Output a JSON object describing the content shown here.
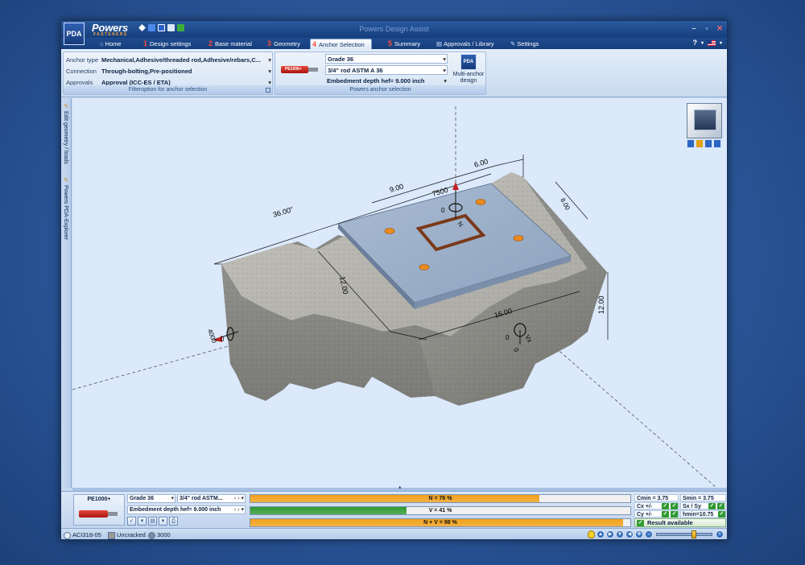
{
  "app": {
    "title": "Powers Design Assist",
    "logo_text": "PDA",
    "brand": "Powers",
    "brand_sub": "FASTENERS"
  },
  "tabs": [
    {
      "num": "",
      "label": "Home",
      "icon": "home-icon"
    },
    {
      "num": "1",
      "label": "Design settings"
    },
    {
      "num": "2",
      "label": "Base material"
    },
    {
      "num": "3",
      "label": "Geometry"
    },
    {
      "num": "4",
      "label": "Anchor Selection",
      "active": true
    },
    {
      "num": "5",
      "label": "Summary"
    },
    {
      "num": "",
      "label": "Approvals / Library",
      "icon": "book-icon"
    },
    {
      "num": "",
      "label": "Settings",
      "icon": "wrench-icon"
    }
  ],
  "help_label": "?",
  "filter_group": {
    "caption": "Filteroption for anchor selection",
    "rows": [
      {
        "label": "Anchor type",
        "value": "Mechanical,Adhesive/threaded rod,Adhesive/rebars,C..."
      },
      {
        "label": "Connection",
        "value": "Through-bolting,Pre-positioned"
      },
      {
        "label": "Approvals",
        "value": "Approval (ICC-ES / ETA)"
      }
    ]
  },
  "anchor_group": {
    "caption": "Powers anchor selection",
    "product_label": "PE1000+",
    "grade": "Grade 36",
    "rod": "3/4\" rod  ASTM A 36",
    "embedment": "Embedment depth hef= 9.000 inch",
    "multi_anchor_label": "Multi-anchor design",
    "multi_anchor_icon_text": "PDA"
  },
  "sidebar": {
    "items": [
      {
        "label": "Edit geometry / loads"
      },
      {
        "label": "Powers PDA-Explorer"
      }
    ]
  },
  "model": {
    "dims": [
      "36.00\"",
      "9.00",
      "6.00",
      "12.00",
      "16.00",
      "12.00",
      "8.00"
    ],
    "loads": {
      "moment_top": "7500",
      "zero_top": "0",
      "zero_left": "0",
      "moment_left": "4000",
      "moment_right": "0",
      "zero_right": "0"
    }
  },
  "results": {
    "product_label": "PE1000+",
    "grade": "Grade 36",
    "rod": "3/4\" rod  ASTM...",
    "embedment": "Embedment depth hef= 9.000 inch",
    "bars": [
      {
        "label": "N = 76 %",
        "value": 76,
        "color": "#f2a21b"
      },
      {
        "label": "V = 41 %",
        "value": 41,
        "color": "#2e9b32"
      },
      {
        "label": "N + V = 98 %",
        "value": 98,
        "color": "#f2a21b"
      }
    ],
    "checks": {
      "cmin": "Cmin = 3.75",
      "smin": "Smin = 3.75",
      "cx": "Cx +/-",
      "sx": "Sx / Sy",
      "cy": "Cy +/-",
      "hmin": "hmin=10.75"
    },
    "result_available": "Result available"
  },
  "status": {
    "code": "ACI318-05",
    "concrete": "Uncracked",
    "strength": "3000"
  },
  "zoom": {
    "level": 0.68
  },
  "colors": {
    "accent": "#153e7c",
    "orange": "#f2a21b",
    "green": "#2e9b32"
  }
}
